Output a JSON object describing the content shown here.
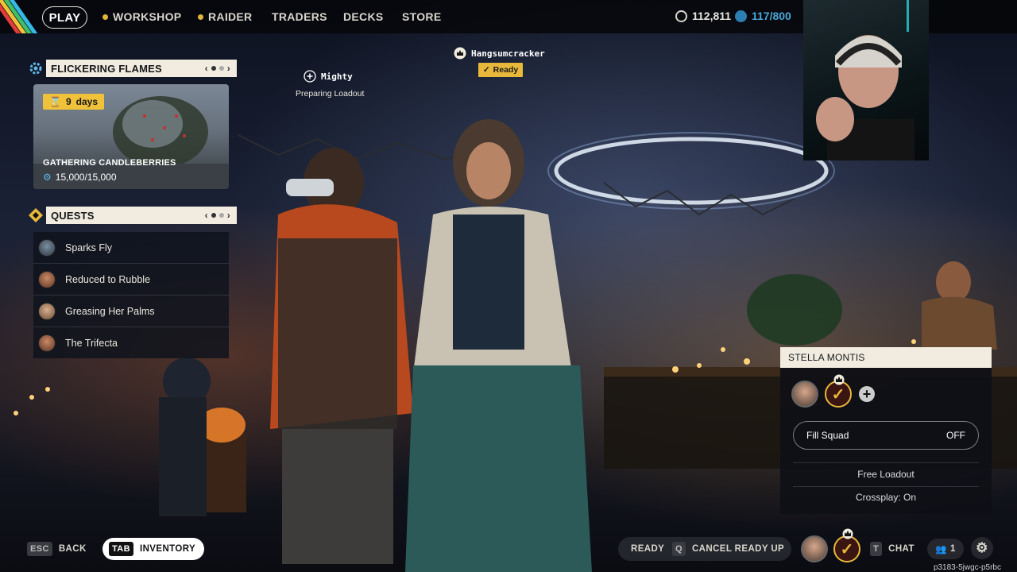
{
  "nav": {
    "play": "PLAY",
    "items": [
      "WORKSHOP",
      "RAIDER",
      "TRADERS",
      "DECKS",
      "STORE"
    ]
  },
  "currency": {
    "coins": "112,811",
    "tokens": "117/800"
  },
  "event": {
    "header": "FLICKERING FLAMES",
    "days_num": "9",
    "days_unit": "days",
    "title": "GATHERING CANDLEBERRIES",
    "progress": "15,000/15,000"
  },
  "quests": {
    "header": "QUESTS",
    "items": [
      "Sparks Fly",
      "Reduced to Rubble",
      "Greasing Her Palms",
      "The Trifecta"
    ]
  },
  "players": {
    "leader_name": "Hangsumcracker",
    "leader_status": "Ready",
    "second_name": "Mighty",
    "second_status": "Preparing Loadout"
  },
  "squad": {
    "location": "STELLA MONTIS",
    "fill_label": "Fill Squad",
    "fill_value": "OFF",
    "free_loadout": "Free Loadout",
    "crossplay": "Crossplay: On"
  },
  "footer": {
    "back_key": "ESC",
    "back": "BACK",
    "inv_key": "TAB",
    "inventory": "INVENTORY",
    "ready": "READY",
    "cancel_key": "Q",
    "cancel": "CANCEL READY UP",
    "chat_key": "T",
    "chat": "CHAT",
    "friends_count": "1"
  },
  "watermark": "p3183-5jwgc-p5rbc",
  "colors": {
    "accent_yellow": "#e7b83a",
    "panel_cream": "#f1ecdf",
    "panel_dark": "#0e121c"
  }
}
